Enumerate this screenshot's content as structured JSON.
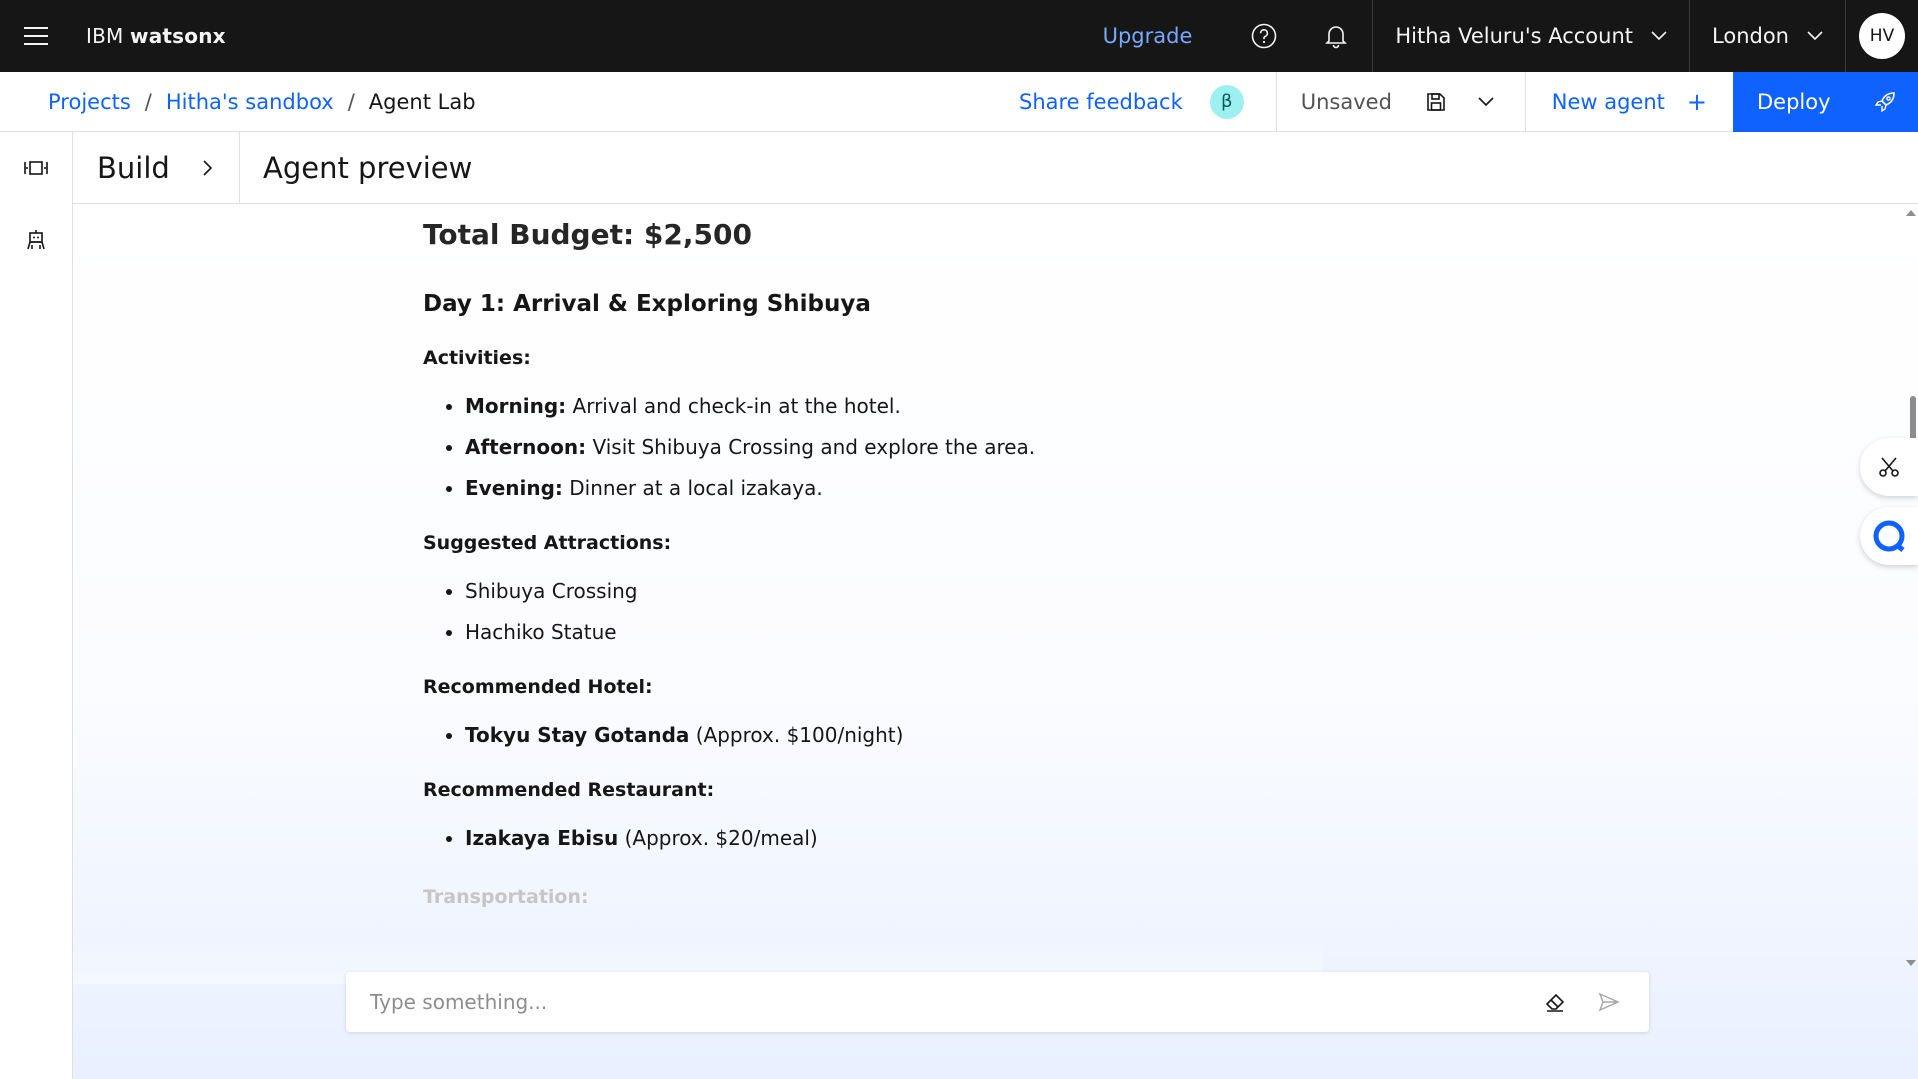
{
  "header": {
    "brand_prefix": "IBM",
    "brand_name": "watsonx",
    "upgrade": "Upgrade",
    "account": "Hitha Veluru's Account",
    "region": "London",
    "avatar_initials": "HV"
  },
  "subbar": {
    "breadcrumb": [
      "Projects",
      "Hitha's sandbox",
      "Agent Lab"
    ],
    "separator": "/",
    "share_feedback": "Share feedback",
    "beta": "β",
    "status": "Unsaved",
    "new_agent": "New agent",
    "deploy": "Deploy"
  },
  "panel": {
    "build": "Build",
    "title": "Agent preview"
  },
  "chat": {
    "budget_heading": "Total Budget: $2,500",
    "day_heading": "Day 1: Arrival & Exploring Shibuya",
    "activities_heading": "Activities:",
    "activities": [
      {
        "label": "Morning:",
        "text": " Arrival and check-in at the hotel."
      },
      {
        "label": "Afternoon:",
        "text": " Visit Shibuya Crossing and explore the area."
      },
      {
        "label": "Evening:",
        "text": " Dinner at a local izakaya."
      }
    ],
    "attractions_heading": "Suggested Attractions:",
    "attractions": [
      "Shibuya Crossing",
      "Hachiko Statue"
    ],
    "hotel_heading": "Recommended Hotel:",
    "hotel": {
      "label": "Tokyu Stay Gotanda",
      "text": " (Approx. $100/night)"
    },
    "restaurant_heading": "Recommended Restaurant:",
    "restaurant": {
      "label": "Izakaya Ebisu",
      "text": " (Approx. $20/meal)"
    },
    "transport_heading": "Transportation:"
  },
  "input": {
    "placeholder": "Type something...",
    "value": ""
  },
  "colors": {
    "header_bg": "#161616",
    "link": "#0f62fe",
    "upgrade": "#78a9ff",
    "deploy_bg": "#0f62fe",
    "beta_bg": "#9ef0f0"
  },
  "icons": [
    "menu-icon",
    "help-icon",
    "notification-icon",
    "chevron-down-icon",
    "save-icon",
    "add-icon",
    "rocket-icon",
    "chevron-right-icon",
    "layout-icon",
    "agent-icon",
    "eraser-icon",
    "send-icon",
    "scissors-icon",
    "chat-icon"
  ]
}
